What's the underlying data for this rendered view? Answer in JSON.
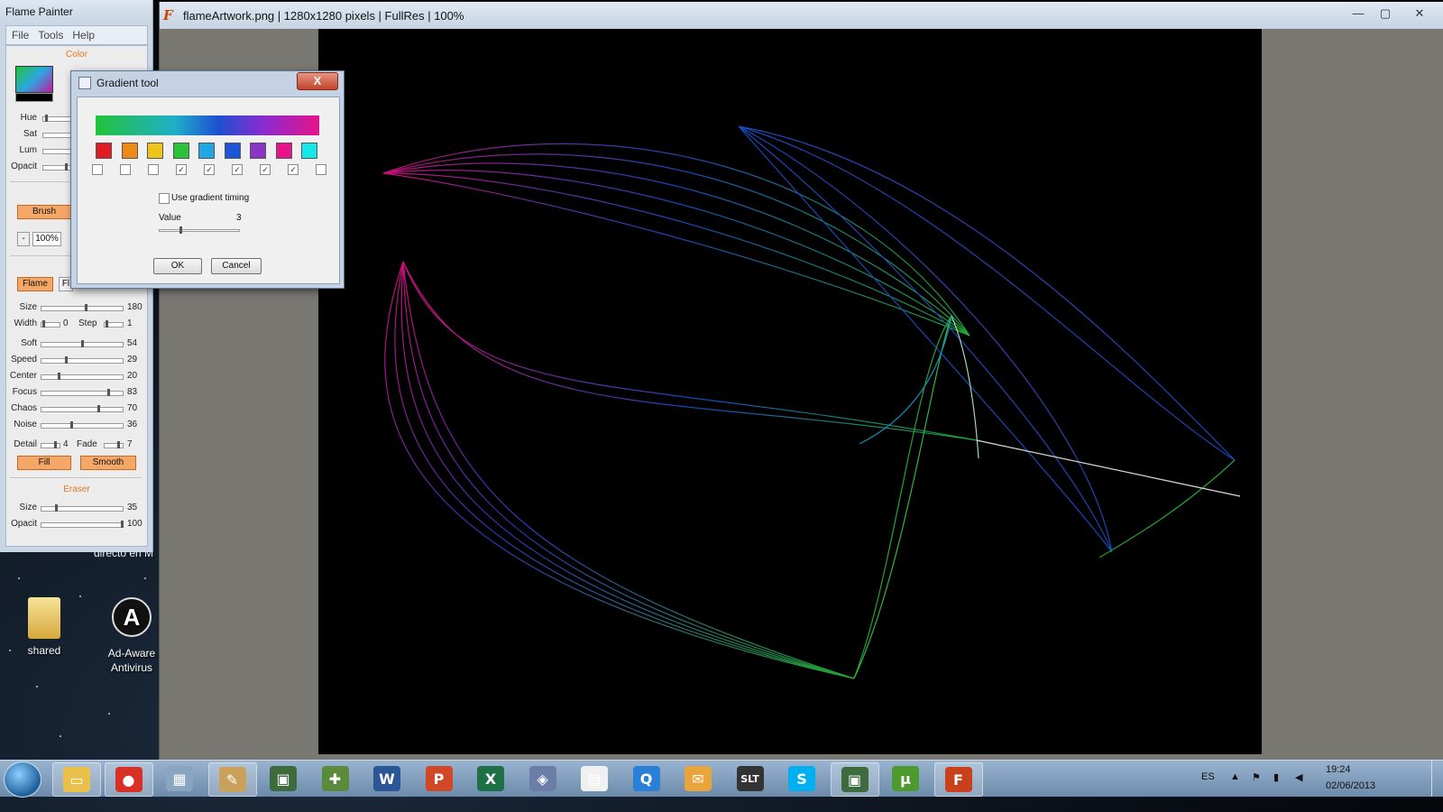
{
  "left_panel": {
    "title": "Flame Painter",
    "menu": [
      "File",
      "Tools",
      "Help"
    ],
    "color_section": "Color",
    "color_sliders": [
      {
        "label": "Hue"
      },
      {
        "label": "Sat"
      },
      {
        "label": "Lum"
      },
      {
        "label": "Opacit"
      }
    ],
    "brush_button": "Brush",
    "zoom_minus": "-",
    "zoom_value": "100%",
    "flame_button": "Flame",
    "flame_button2": "Fl",
    "brush_params": [
      {
        "label": "Size",
        "value": "180",
        "level": 0.55
      },
      {
        "label": "Soft",
        "value": "54",
        "level": 0.5
      },
      {
        "label": "Speed",
        "value": "29",
        "level": 0.29
      },
      {
        "label": "Center",
        "value": "20",
        "level": 0.2
      },
      {
        "label": "Focus",
        "value": "83",
        "level": 0.83
      },
      {
        "label": "Chaos",
        "value": "70",
        "level": 0.7
      },
      {
        "label": "Noise",
        "value": "36",
        "level": 0.36
      }
    ],
    "width_label": "Width",
    "width_value": "0",
    "step_label": "Step",
    "step_value": "1",
    "detail_label": "Detail",
    "detail_value": "4",
    "fade_label": "Fade",
    "fade_value": "7",
    "fill_button": "Fill",
    "smooth_button": "Smooth",
    "eraser_section": "Eraser",
    "eraser_params": [
      {
        "label": "Size",
        "value": "35",
        "level": 0.17
      },
      {
        "label": "Opacit",
        "value": "100",
        "level": 1.0
      }
    ]
  },
  "dialog": {
    "title": "Gradient tool",
    "close": "X",
    "swatches": [
      {
        "color": "#e31c23",
        "checked": false
      },
      {
        "color": "#ee8a17",
        "checked": false
      },
      {
        "color": "#ecc41a",
        "checked": false
      },
      {
        "color": "#2bc23b",
        "checked": true
      },
      {
        "color": "#1ea7e0",
        "checked": true
      },
      {
        "color": "#1c56d6",
        "checked": true
      },
      {
        "color": "#8a35c6",
        "checked": true
      },
      {
        "color": "#e6138a",
        "checked": true
      },
      {
        "color": "#13e8ea",
        "checked": false
      }
    ],
    "use_gradient_timing": "Use gradient timing",
    "value_label": "Value",
    "value": "3",
    "ok": "OK",
    "cancel": "Cancel"
  },
  "main_window": {
    "title": "flameArtwork.png | 1280x1280 pixels | FullRes | 100%",
    "icon": "flame-painter-icon"
  },
  "desktop": {
    "partial_text": "directo en M",
    "icons": [
      {
        "label": "shared",
        "icon": "folder-icon"
      },
      {
        "label": "Ad-Aware Antivirus",
        "icon": "ad-aware-icon"
      }
    ]
  },
  "taskbar": {
    "apps": [
      {
        "name": "explorer-icon",
        "glyph": "▭",
        "color": "#e8c04a"
      },
      {
        "name": "chrome-icon",
        "glyph": "●",
        "color": "#d93025"
      },
      {
        "name": "calculator-icon",
        "glyph": "▦",
        "color": "#8aa5c0"
      },
      {
        "name": "paint-icon",
        "glyph": "✎",
        "color": "#c9a15a"
      },
      {
        "name": "monitor-app-icon",
        "glyph": "▣",
        "color": "#3d6b3d"
      },
      {
        "name": "joystick-icon",
        "glyph": "✚",
        "color": "#5b8a3a"
      },
      {
        "name": "word-icon",
        "glyph": "W",
        "color": "#2b5797"
      },
      {
        "name": "powerpoint-icon",
        "glyph": "P",
        "color": "#d24726"
      },
      {
        "name": "excel-icon",
        "glyph": "X",
        "color": "#1e7145"
      },
      {
        "name": "virtualbox-icon",
        "glyph": "◈",
        "color": "#6a7ea8"
      },
      {
        "name": "calendar-icon",
        "glyph": "▤",
        "color": "#f0f0f0"
      },
      {
        "name": "search-icon",
        "glyph": "Q",
        "color": "#2a7fd6"
      },
      {
        "name": "envelope-icon",
        "glyph": "✉",
        "color": "#e9a43a"
      },
      {
        "name": "slt-icon",
        "glyph": "SLT",
        "color": "#333333"
      },
      {
        "name": "skype-icon",
        "glyph": "S",
        "color": "#00aff0"
      },
      {
        "name": "monitor-app2-icon",
        "glyph": "▣",
        "color": "#3d6b3d"
      },
      {
        "name": "utorrent-icon",
        "glyph": "µ",
        "color": "#4d9a2f"
      },
      {
        "name": "flame-painter-icon",
        "glyph": "F",
        "color": "#c9411b"
      }
    ],
    "language": "ES",
    "time": "19:24",
    "date": "02/06/2013"
  }
}
